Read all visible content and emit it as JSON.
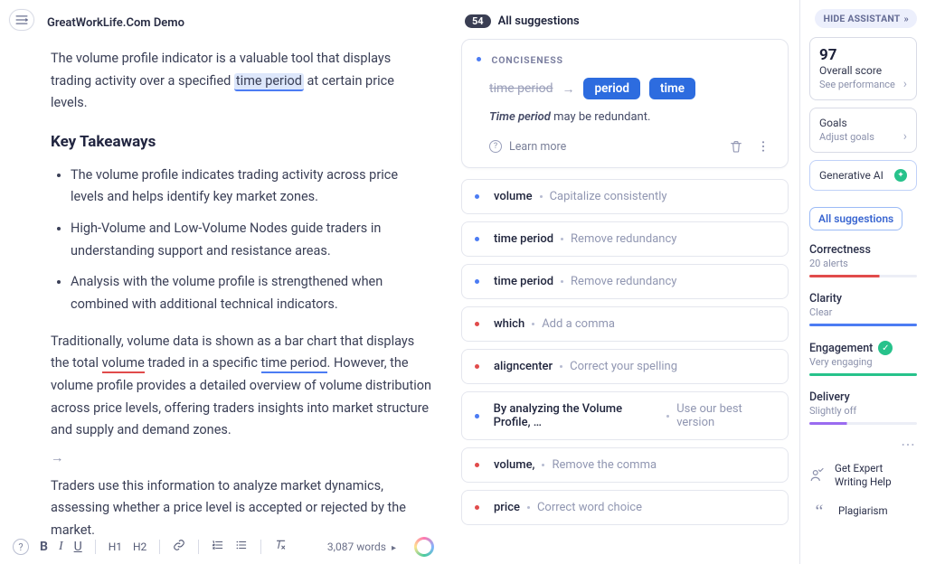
{
  "header": {
    "doc_title": "GreatWorkLife.Com Demo",
    "suggestion_count": "54",
    "all_suggestions_label": "All suggestions"
  },
  "document": {
    "p1_a": "The volume profile indicator is a valuable tool that displays trading activity over a specified ",
    "p1_hl": "time period",
    "p1_b": " at certain price levels.",
    "h_key": "Key Takeaways",
    "k1": "The volume profile indicates trading activity across price levels and helps identify key market zones.",
    "k2": "High-Volume and Low-Volume Nodes guide traders in understanding support and resistance areas.",
    "k3": "Analysis with the volume profile is strengthened when combined with additional technical indicators.",
    "p2_a": "Traditionally, volume data is shown as a bar chart that displays the total ",
    "p2_vol": "volume",
    "p2_b": " traded in a specific ",
    "p2_tp": "time period",
    "p2_c": ". However, the volume profile provides a detailed overview of volume distribution across price levels, offering traders insights into market structure and supply and demand zones.",
    "arrow": "→",
    "p3": "Traders use this information to analyze market dynamics, assessing whether a price level is accepted or rejected by the market."
  },
  "toolbar": {
    "bold": "B",
    "italic": "I",
    "underline": "U",
    "h1": "H1",
    "h2": "H2",
    "link": "🔗",
    "ol": "≡",
    "ul": "≔",
    "clear": "✕",
    "word_count": "3,087 words",
    "caret": "▸"
  },
  "main_card": {
    "tag": "CONCISENESS",
    "strike": "time period",
    "chip1": "period",
    "chip2": "time",
    "desc_bold": "Time period",
    "desc_rest": " may be redundant.",
    "learn_more": "Learn more"
  },
  "mini_suggestions": [
    {
      "dot": "blue",
      "term": "volume",
      "hint": "Capitalize consistently"
    },
    {
      "dot": "blue",
      "term": "time period",
      "hint": "Remove redundancy"
    },
    {
      "dot": "blue",
      "term": "time period",
      "hint": "Remove redundancy"
    },
    {
      "dot": "red",
      "term": "which",
      "hint": "Add a comma"
    },
    {
      "dot": "red",
      "term": "aligncenter",
      "hint": "Correct your spelling"
    },
    {
      "dot": "blue",
      "term": "By analyzing the Volume Profile, …",
      "hint": "Use our best version"
    },
    {
      "dot": "red",
      "term": "volume,",
      "hint": "Remove the comma"
    },
    {
      "dot": "red",
      "term": "price",
      "hint": "Correct word choice"
    }
  ],
  "right": {
    "hide_label": "HIDE ASSISTANT",
    "score": "97",
    "score_label": "Overall score",
    "score_sub": "See performance",
    "goals_label": "Goals",
    "goals_sub": "Adjust goals",
    "gen_label": "Generative AI",
    "all_sug": "All suggestions",
    "categories": [
      {
        "name": "Correctness",
        "sub": "20 alerts",
        "color": "#e14b4b",
        "width": "65%"
      },
      {
        "name": "Clarity",
        "sub": "Clear",
        "color": "#4c7cf3",
        "width": "100%"
      },
      {
        "name": "Engagement",
        "sub": "Very engaging",
        "color": "#27c28b",
        "width": "100%",
        "check": true
      },
      {
        "name": "Delivery",
        "sub": "Slightly off",
        "color": "#9a6bf0",
        "width": "35%"
      }
    ],
    "expert": "Get Expert Writing Help",
    "plag": "Plagiarism"
  }
}
